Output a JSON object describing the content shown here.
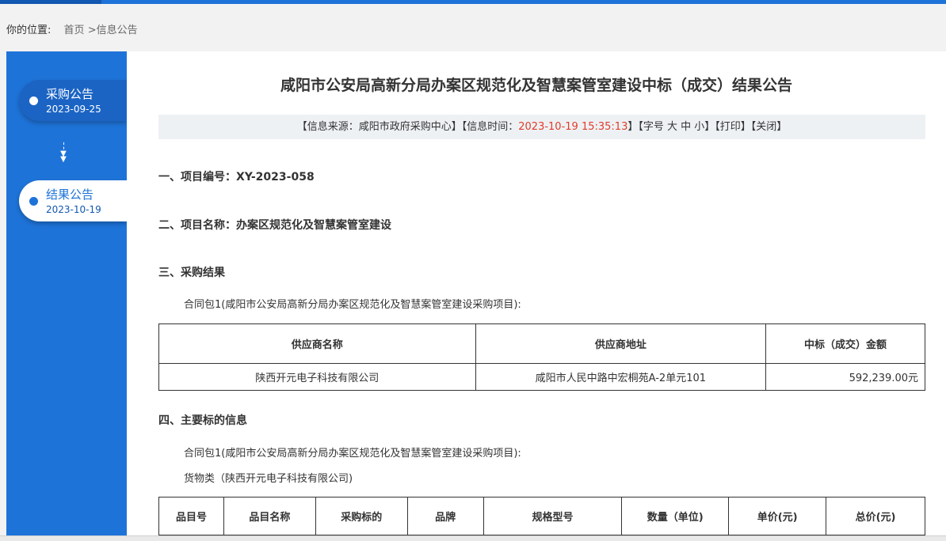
{
  "breadcrumb": {
    "label": "你的位置:",
    "home": "首页",
    "separator": ">",
    "current": "信息公告"
  },
  "sidebar": {
    "steps": [
      {
        "title": "采购公告",
        "date": "2023-09-25"
      },
      {
        "title": "结果公告",
        "date": "2023-10-19"
      }
    ],
    "arrow": "⇣"
  },
  "article": {
    "title": "咸阳市公安局高新分局办案区规范化及智慧案管室建设中标（成交）结果公告",
    "info": {
      "source_prefix": "【信息来源：咸阳市政府采购中心】【信息时间：",
      "time": "2023-10-19 15:35:13",
      "suffix": "】【字号 大 中 小】【打印】【关闭】"
    },
    "sections": {
      "s1_label": "一、项目编号：",
      "s1_value": "XY-2023-058",
      "s2_label": "二、项目名称：",
      "s2_value": "办案区规范化及智慧案管室建设",
      "s3_label": "三、采购结果",
      "s3_para": "合同包1(咸阳市公安局高新分局办案区规范化及智慧案管室建设采购项目):",
      "s4_label": "四、主要标的信息",
      "s4_para1": "合同包1(咸阳市公安局高新分局办案区规范化及智慧案管室建设采购项目):",
      "s4_para2": "货物类（陕西开元电子科技有限公司)"
    },
    "result_table": {
      "headers": [
        "供应商名称",
        "供应商地址",
        "中标（成交）金额"
      ],
      "rows": [
        [
          "陕西开元电子科技有限公司",
          "咸阳市人民中路中宏桐苑A-2单元101",
          "592,239.00元"
        ]
      ]
    },
    "item_table": {
      "headers": [
        "品目号",
        "品目名称",
        "采购标的",
        "品牌",
        "规格型号",
        "数量（单位)",
        "单价(元)",
        "总价(元)"
      ]
    }
  }
}
